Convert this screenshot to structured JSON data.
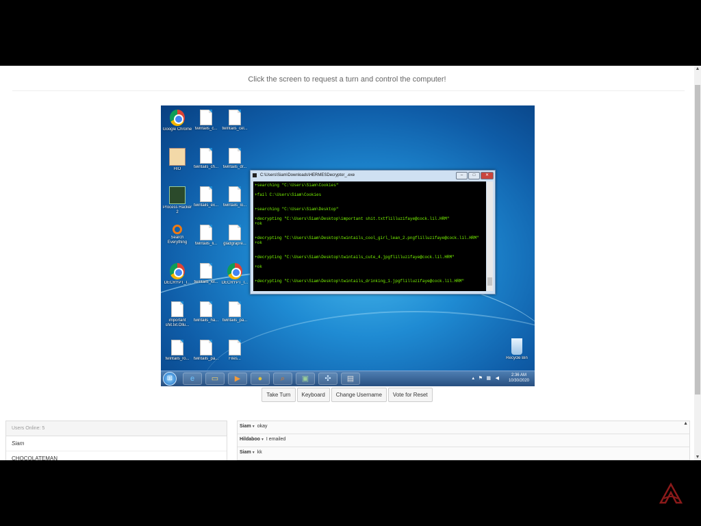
{
  "page": {
    "instruction": "Click the screen to request a turn and control the computer!"
  },
  "desktop": {
    "icons": [
      {
        "label": "Google Chrome",
        "icon": "chrome-icon"
      },
      {
        "label": "twintails_c...",
        "icon": "document-icon"
      },
      {
        "label": "twintails_cel...",
        "icon": "document-icon"
      },
      {
        "label": "HIO",
        "icon": "hio-app-icon"
      },
      {
        "label": "twintails_ch...",
        "icon": "document-icon"
      },
      {
        "label": "twintails_dr...",
        "icon": "document-icon"
      },
      {
        "label": "Process Hacker 2",
        "icon": "process-hacker-icon"
      },
      {
        "label": "twintails_ex...",
        "icon": "document-icon"
      },
      {
        "label": "twintails_lo...",
        "icon": "document-icon"
      },
      {
        "label": "Search Everything",
        "icon": "search-everything-icon"
      },
      {
        "label": "twintails_li...",
        "icon": "document-icon"
      },
      {
        "label": "gladgrapre...",
        "icon": "image-file-icon"
      },
      {
        "label": "DECRYPT_I...",
        "icon": "chrome-icon"
      },
      {
        "label": "twintails_kil...",
        "icon": "document-icon"
      },
      {
        "label": "DECRYPT_I...",
        "icon": "chrome-icon"
      },
      {
        "label": "important shit.txt.Ollu...",
        "icon": "document-icon"
      },
      {
        "label": "twintails_ha...",
        "icon": "document-icon"
      },
      {
        "label": "twintails_pa...",
        "icon": "document-icon"
      },
      {
        "label": "twintails_ro...",
        "icon": "document-icon"
      },
      {
        "label": "twintails_pa...",
        "icon": "document-icon"
      },
      {
        "label": "Files...",
        "icon": "document-icon"
      },
      {
        "label": "Recycle Bin",
        "icon": "recycle-bin-icon"
      }
    ],
    "cmd_window": {
      "title": "C:\\Users\\Siam\\Downloads\\HERMESDecryptor_.exe",
      "lines": [
        "+searching \"C:\\Users\\Siam\\Cookies\"",
        "",
        "+fail C:\\Users\\Siam\\Cookies",
        "",
        "",
        "+searching \"C:\\Users\\Siam\\Desktop\"",
        "",
        "+decrypting \"C:\\Users\\Siam\\Desktop\\important shit.txtflilluzifaye@cock.lil.HRM\"",
        "+ok",
        "",
        "",
        "+decrypting \"C:\\Users\\Siam\\Desktop\\twintails_cool_girl_lean_2.pngflilluzifaye@cock.lil.HRM\"",
        "+ok",
        "",
        "",
        "+decrypting \"C:\\Users\\Siam\\Desktop\\twintails_cute_4.jpgflilluzifaye@cock.lil.HRM\"",
        "",
        "+ok",
        "",
        "",
        "+decrypting \"C:\\Users\\Siam\\Desktop\\twintails_drinking_1.jpgflilluzifaye@cock.lil.HRM\""
      ]
    },
    "taskbar": {
      "apps": [
        "internet-explorer-icon",
        "folder-icon",
        "media-player-icon",
        "chrome-icon",
        "search-everything-icon",
        "process-hacker-icon",
        "network-icon",
        "cmd-icon"
      ],
      "time": "2:36 AM",
      "date": "10/30/2020"
    }
  },
  "controls": {
    "take_turn": "Take Turn",
    "keyboard": "Keyboard",
    "change_username": "Change Username",
    "vote_reset": "Vote for Reset"
  },
  "users": {
    "header": "Users Online: 5",
    "list": [
      "Siam",
      "CHOCOLATEMAN"
    ]
  },
  "chat": {
    "messages": [
      {
        "user": "Siam",
        "text": "okay"
      },
      {
        "user": "Hildaboo",
        "text": "I emailed"
      },
      {
        "user": "Siam",
        "text": "kk"
      }
    ]
  },
  "colors": {
    "desktop_blue": "#1f8bd3",
    "console_green": "#7CFC00",
    "page_bg": "#ffffff",
    "outer_bg": "#000000"
  }
}
